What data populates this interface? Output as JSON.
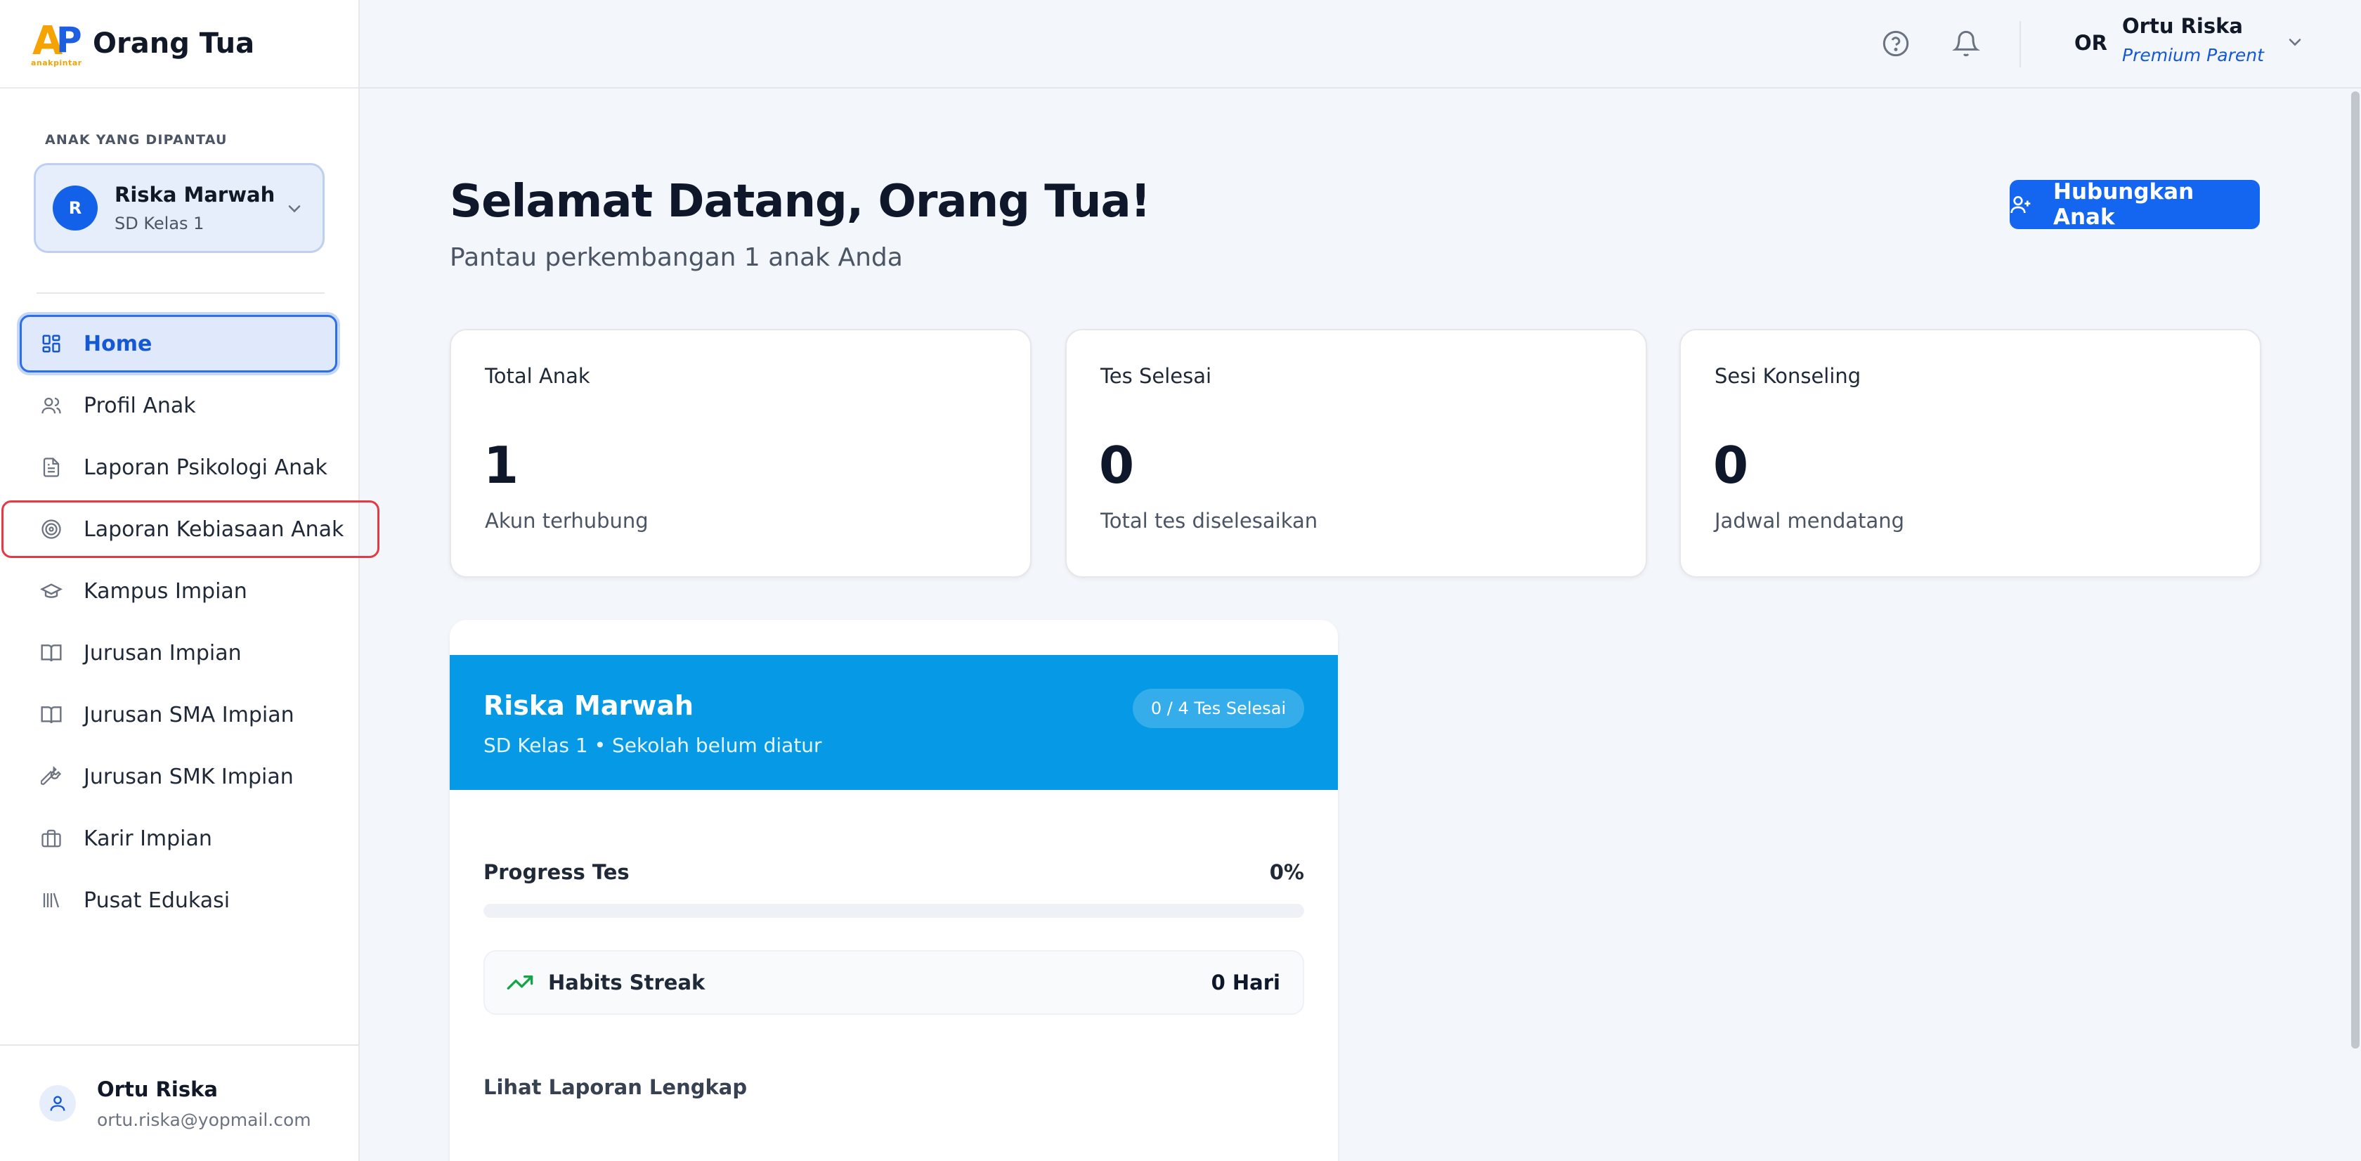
{
  "brand": {
    "logo_mark": "AP",
    "logo_sub": "anakpintar",
    "title": "Orang Tua"
  },
  "sidebar": {
    "section_label": "ANAK YANG DIPANTAU",
    "child": {
      "initial": "R",
      "name": "Riska Marwah",
      "grade": "SD Kelas 1"
    },
    "items": [
      {
        "label": "Home",
        "icon": "grid-icon"
      },
      {
        "label": "Profil Anak",
        "icon": "users-icon"
      },
      {
        "label": "Laporan Psikologi Anak",
        "icon": "document-icon"
      },
      {
        "label": "Laporan Kebiasaan Anak",
        "icon": "target-icon"
      },
      {
        "label": "Kampus Impian",
        "icon": "graduation-cap-icon"
      },
      {
        "label": "Jurusan Impian",
        "icon": "book-open-icon"
      },
      {
        "label": "Jurusan SMA Impian",
        "icon": "book-open-icon"
      },
      {
        "label": "Jurusan SMK Impian",
        "icon": "wrench-icon"
      },
      {
        "label": "Karir Impian",
        "icon": "briefcase-icon"
      },
      {
        "label": "Pusat Edukasi",
        "icon": "library-icon"
      }
    ],
    "footer": {
      "name": "Ortu Riska",
      "email": "ortu.riska@yopmail.com"
    }
  },
  "header": {
    "initials": "OR",
    "user_name": "Ortu Riska",
    "user_role": "Premium Parent"
  },
  "main": {
    "welcome": "Selamat Datang, Orang Tua!",
    "subtitle": "Pantau perkembangan 1 anak Anda",
    "connect_button": "Hubungkan Anak",
    "stats": [
      {
        "label": "Total Anak",
        "value": "1",
        "desc": "Akun terhubung"
      },
      {
        "label": "Tes Selesai",
        "value": "0",
        "desc": "Total tes diselesaikan"
      },
      {
        "label": "Sesi Konseling",
        "value": "0",
        "desc": "Jadwal mendatang"
      }
    ],
    "child_card": {
      "name": "Riska Marwah",
      "sub": "SD Kelas 1 • Sekolah belum diatur",
      "badge": "0 / 4 Tes Selesai",
      "progress_label": "Progress Tes",
      "progress_value": "0%",
      "progress_fraction": 0,
      "streak_label": "Habits Streak",
      "streak_value": "0 Hari",
      "report_title": "Lihat Laporan Lengkap"
    }
  },
  "colors": {
    "primary": "#1466f0",
    "card_header": "#069ae6",
    "highlight_border": "#e53945",
    "streak_green": "#16a34a"
  }
}
